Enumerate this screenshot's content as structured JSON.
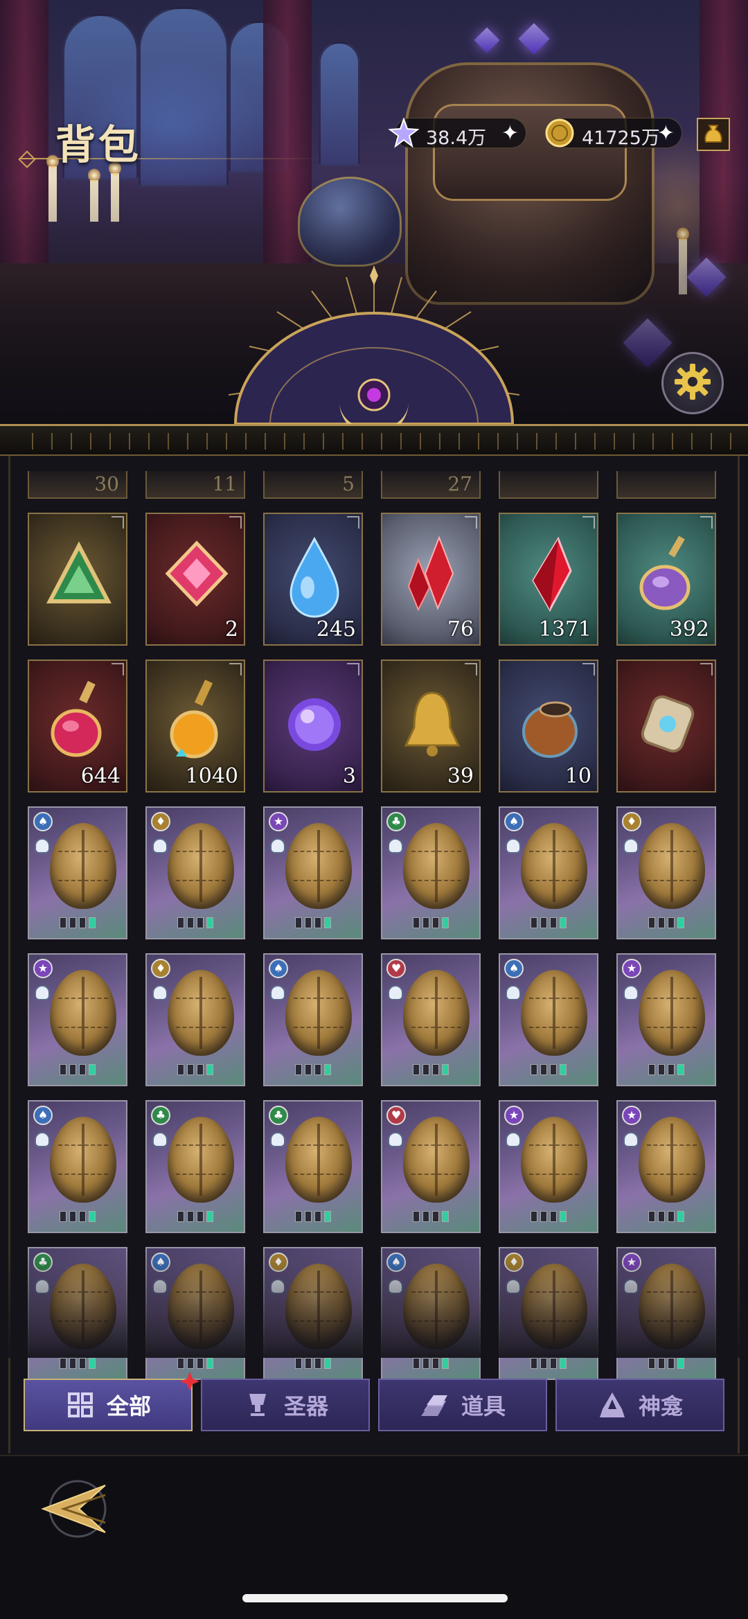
{
  "header": {
    "title": "背包",
    "currencies": [
      {
        "icon": "star-crystal-icon",
        "amount": "38.4万",
        "plus": "✦"
      },
      {
        "icon": "gold-coin-icon",
        "amount": "41725万",
        "plus": "✦"
      }
    ],
    "shop_icon": "gold-pouch-icon",
    "settings_icon": "gear-icon"
  },
  "inventory": {
    "partial_row": [
      "30",
      "11",
      "5",
      "27",
      "",
      ""
    ],
    "items_row1": [
      {
        "name": "green-triangle-rune",
        "qty": "",
        "bg": "gold"
      },
      {
        "name": "pink-square-gem",
        "qty": "2",
        "bg": "red"
      },
      {
        "name": "blue-teardrop-gem",
        "qty": "245",
        "bg": "blue"
      },
      {
        "name": "red-crystal-cluster",
        "qty": "76",
        "bg": "silver"
      },
      {
        "name": "red-crystal-shard",
        "qty": "1371",
        "bg": "teal"
      },
      {
        "name": "purple-potion-flask",
        "qty": "392",
        "bg": "teal"
      }
    ],
    "items_row2": [
      {
        "name": "red-potion-bottle",
        "qty": "644",
        "bg": "red"
      },
      {
        "name": "amber-potion-bottle",
        "qty": "1040",
        "bg": "gold"
      },
      {
        "name": "purple-orb",
        "qty": "3",
        "bg": "purple"
      },
      {
        "name": "golden-bell",
        "qty": "39",
        "bg": "gold"
      },
      {
        "name": "clay-pot",
        "qty": "10",
        "bg": "blue"
      },
      {
        "name": "ornate-amulet",
        "qty": "",
        "bg": "red"
      }
    ],
    "egg_badges": [
      [
        "blue",
        "gold",
        "purple",
        "green",
        "blue",
        "gold"
      ],
      [
        "purple",
        "gold",
        "blue",
        "red",
        "blue",
        "purple"
      ],
      [
        "blue",
        "green",
        "green",
        "red",
        "purple",
        "purple"
      ],
      [
        "green",
        "blue",
        "gold",
        "blue",
        "gold",
        "purple"
      ]
    ]
  },
  "tabs": [
    {
      "label": "全部",
      "icon": "all-grid-icon",
      "active": true
    },
    {
      "label": "圣器",
      "icon": "chalice-icon",
      "active": false
    },
    {
      "label": "道具",
      "icon": "ingot-icon",
      "active": false
    },
    {
      "label": "神龛",
      "icon": "shrine-icon",
      "active": false
    }
  ],
  "footer": {
    "back_icon": "back-arrow-icon"
  },
  "colors": {
    "accent_gold": "#c9a35a",
    "tab_active": "#5a53a0",
    "tab_inactive": "#3d3670",
    "pip_on": "#2ed0a0"
  }
}
